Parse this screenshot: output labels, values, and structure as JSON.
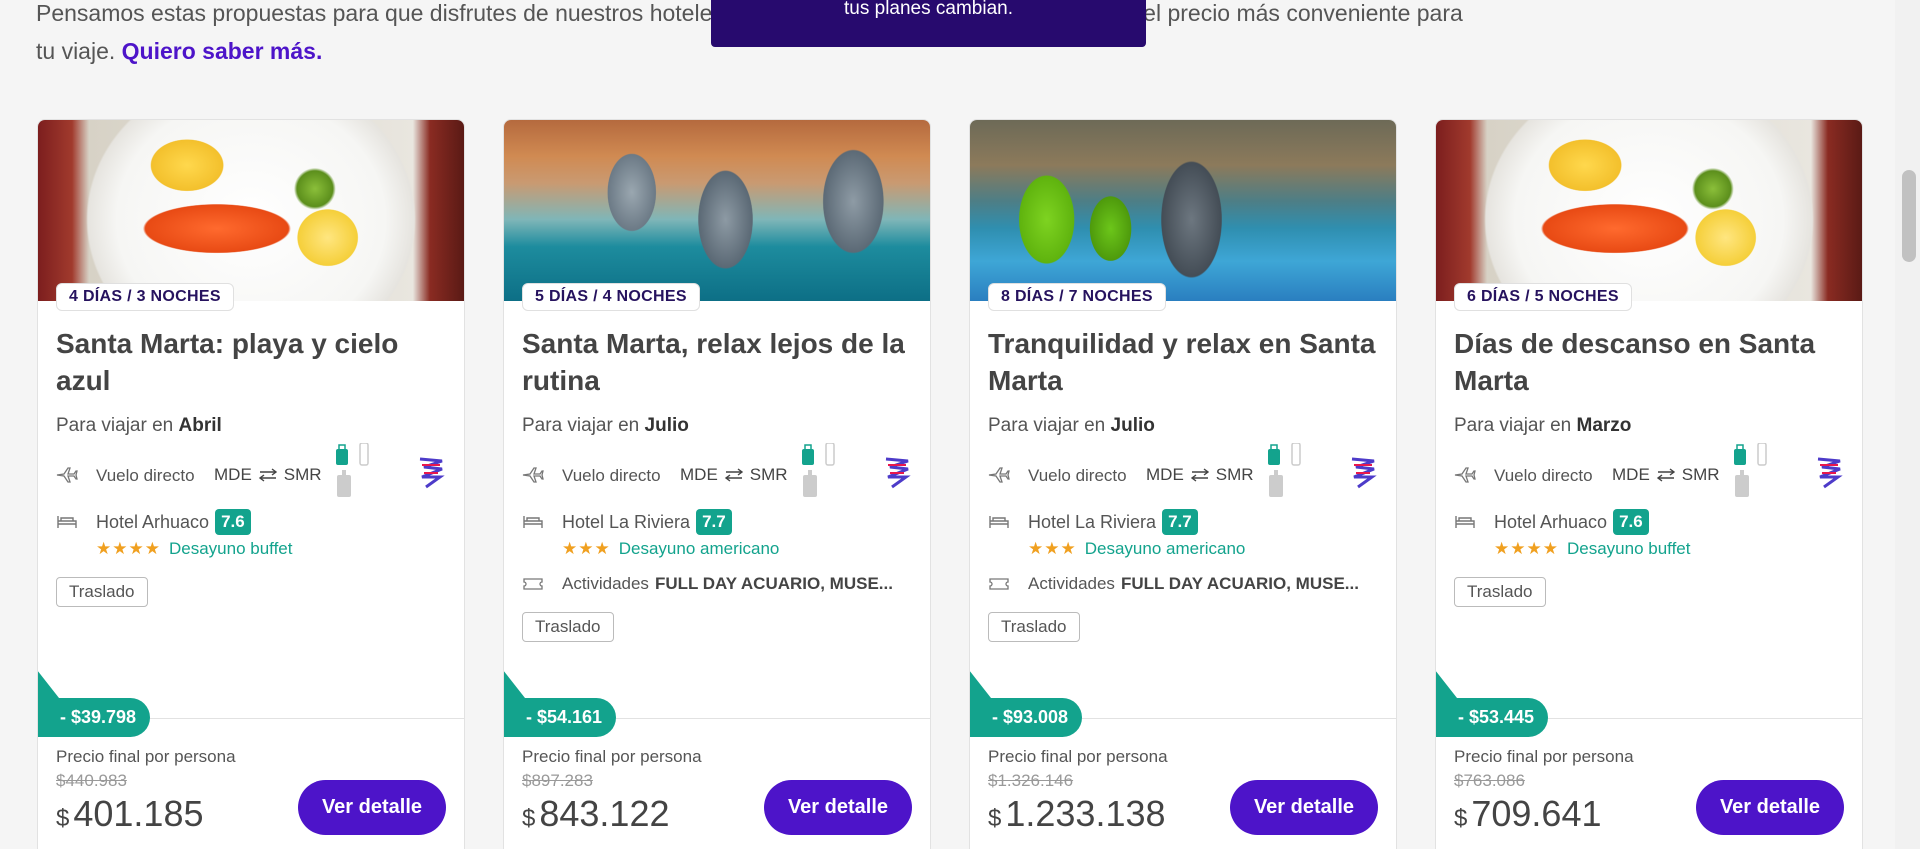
{
  "intro": {
    "text": "Pensamos estas propuestas para que disfrutes de nuestros hoteles favoritos, con actividades imperdibles, y el precio más conveniente para tu viaje.",
    "link": "Quiero saber más."
  },
  "toast": {
    "text": "tus planes cambian."
  },
  "cards": [
    {
      "days": "4 DÍAS / 3 NOCHES",
      "title": "Santa Marta: playa y cielo azul",
      "travel_prefix": "Para viajar en",
      "month": "Abril",
      "flight_label": "Vuelo directo",
      "from": "MDE",
      "to": "SMR",
      "hotel": "Hotel Arhuaco",
      "rating": "7.6",
      "stars": "★★★★",
      "meal": "Desayuno buffet",
      "activities_label": "",
      "activities": "",
      "tag": "Traslado",
      "discount": "- $39.798",
      "price_label": "Precio final por persona",
      "old_price": "$440.983",
      "currency": "$",
      "price": "401.185",
      "button": "Ver detalle"
    },
    {
      "days": "5 DÍAS / 4 NOCHES",
      "title": "Santa Marta, relax lejos de la rutina",
      "travel_prefix": "Para viajar en",
      "month": "Julio",
      "flight_label": "Vuelo directo",
      "from": "MDE",
      "to": "SMR",
      "hotel": "Hotel La Riviera",
      "rating": "7.7",
      "stars": "★★★",
      "meal": "Desayuno americano",
      "activities_label": "Actividades",
      "activities": "FULL DAY ACUARIO, MUSE...",
      "tag": "Traslado",
      "discount": "- $54.161",
      "price_label": "Precio final por persona",
      "old_price": "$897.283",
      "currency": "$",
      "price": "843.122",
      "button": "Ver detalle"
    },
    {
      "days": "8 DÍAS / 7 NOCHES",
      "title": "Tranquilidad y relax en Santa Marta",
      "travel_prefix": "Para viajar en",
      "month": "Julio",
      "flight_label": "Vuelo directo",
      "from": "MDE",
      "to": "SMR",
      "hotel": "Hotel La Riviera",
      "rating": "7.7",
      "stars": "★★★",
      "meal": "Desayuno americano",
      "activities_label": "Actividades",
      "activities": "FULL DAY ACUARIO, MUSE...",
      "tag": "Traslado",
      "discount": "- $93.008",
      "price_label": "Precio final por persona",
      "old_price": "$1.326.146",
      "currency": "$",
      "price": "1.233.138",
      "button": "Ver detalle"
    },
    {
      "days": "6 DÍAS / 5 NOCHES",
      "title": "Días de descanso en Santa Marta",
      "travel_prefix": "Para viajar en",
      "month": "Marzo",
      "flight_label": "Vuelo directo",
      "from": "MDE",
      "to": "SMR",
      "hotel": "Hotel Arhuaco",
      "rating": "7.6",
      "stars": "★★★★",
      "meal": "Desayuno buffet",
      "activities_label": "",
      "activities": "",
      "tag": "Traslado",
      "discount": "- $53.445",
      "price_label": "Precio final por persona",
      "old_price": "$763.086",
      "currency": "$",
      "price": "709.641",
      "button": "Ver detalle"
    }
  ],
  "images": [
    "food-plate",
    "dolphins-show",
    "dolphin-trainers",
    "food-plate"
  ],
  "colors": {
    "accent": "#4d14c9",
    "teal": "#13a38d",
    "toast": "#270a6e"
  }
}
